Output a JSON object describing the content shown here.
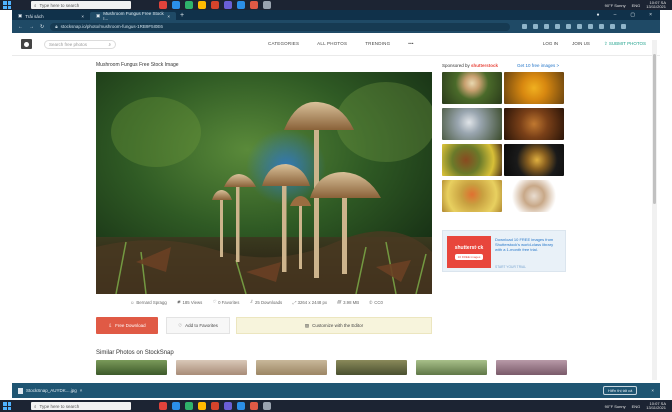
{
  "taskbar": {
    "search_placeholder": "Type here to search",
    "weather": "90°F Sunny",
    "language": "ENG",
    "time": "10:07 SA",
    "date": "13/11/2021"
  },
  "browser": {
    "tabs": [
      {
        "label": "Trải sách"
      },
      {
        "label": "Mushroom Fungus Free Stock I..."
      }
    ],
    "url": "stocksnap.io/photo/mushroom-fungus-1RB9F5I0E6",
    "download_file": "StockSnap_AUYDK....jpg",
    "show_all_label": "Hiển thị tất cả"
  },
  "site": {
    "search_placeholder": "Search free photos",
    "nav": [
      "CATEGORIES",
      "ALL PHOTOS",
      "TRENDING",
      "•••"
    ],
    "nav_right": [
      "LOG IN",
      "JOIN US",
      "SUBMIT PHOTOS"
    ]
  },
  "photo": {
    "title": "Mushroom Fungus Free Stock Image",
    "meta": {
      "author": "Bernard Spragg",
      "views": "185 Views",
      "favorites": "0 Favorites",
      "downloads": "25 Downloads",
      "dimensions": "3264 x 2448 px",
      "size": "3.98 MB",
      "license": "CC0"
    },
    "buttons": {
      "download": "Free Download",
      "favorite": "Add to Favorites",
      "edit": "Customize with the Editor"
    }
  },
  "sidebar": {
    "sponsored_prefix": "Sponsored by",
    "sponsored_brand": "shutterstock",
    "free_images": "Get 10 free images >",
    "ad": {
      "logo_text": "shutterst·ck",
      "logo_button": "10 FREE images",
      "text": "Download 10 FREE images from Shutterstock's world-class library with a 1-month free trial.",
      "link": "START YOUR TRIAL"
    }
  },
  "similar": {
    "title": "Similar Photos on StockSnap"
  },
  "colors": {
    "accent_red": "#e05a45",
    "brand_teal": "#21a28d",
    "browser_dark": "#1f4a66"
  }
}
